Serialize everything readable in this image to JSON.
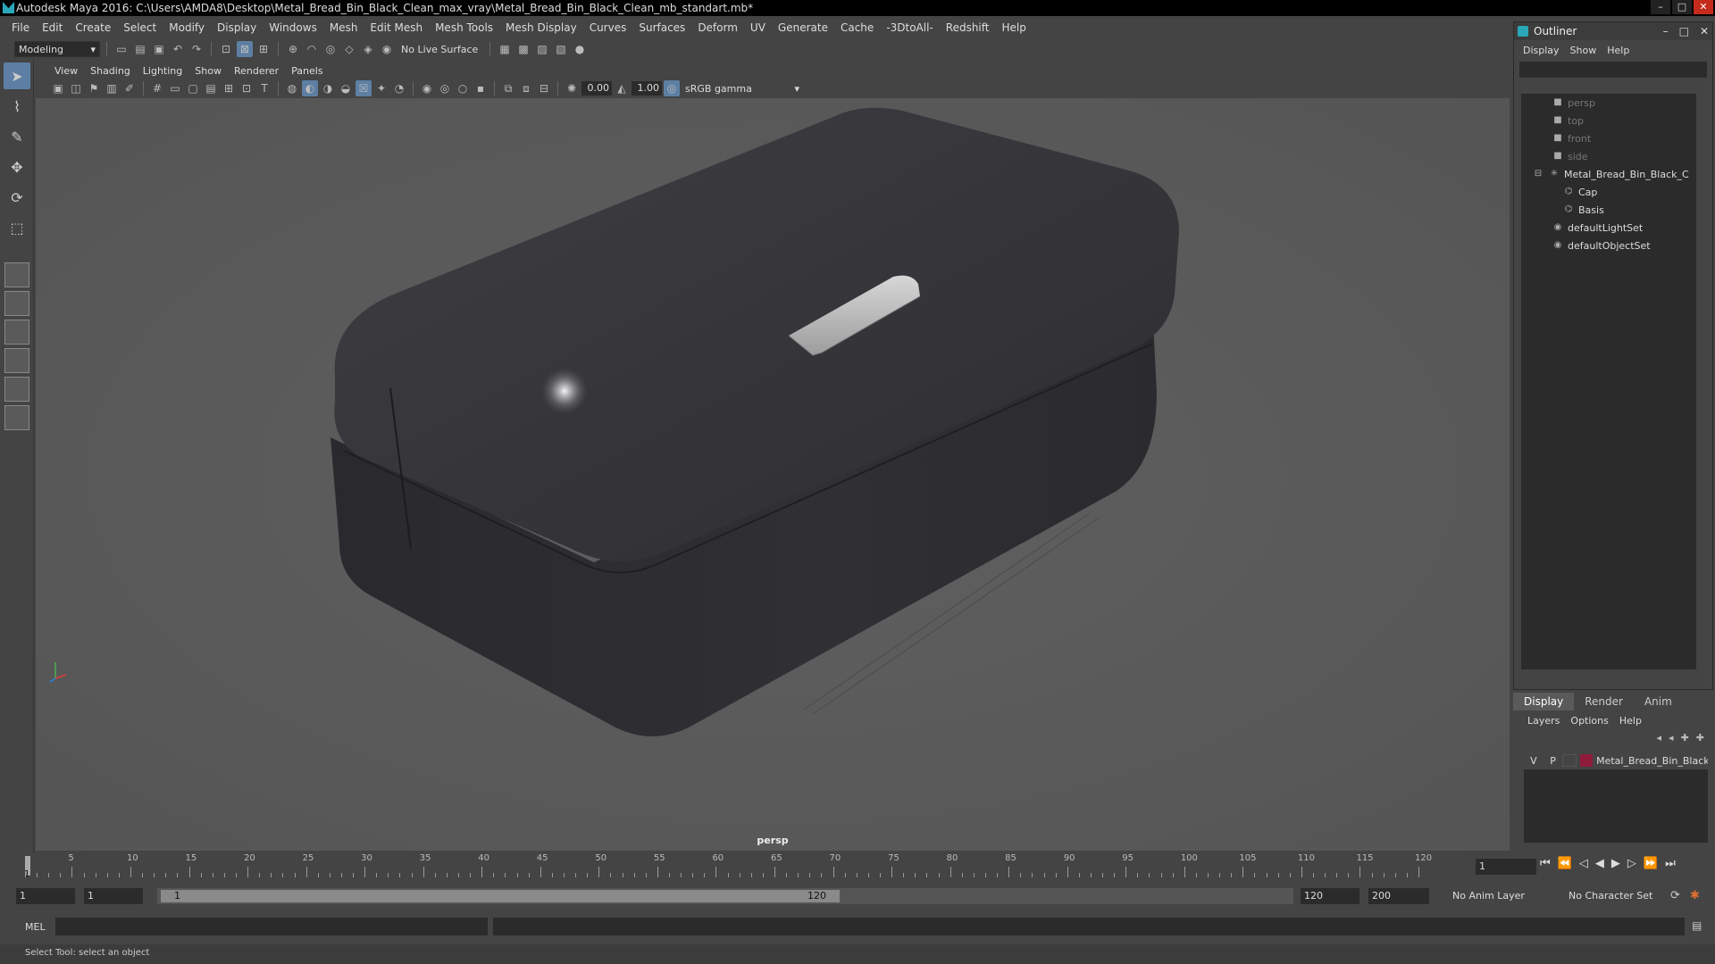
{
  "window": {
    "title": "Autodesk Maya 2016: C:\\Users\\AMDA8\\Desktop\\Metal_Bread_Bin_Black_Clean_max_vray\\Metal_Bread_Bin_Black_Clean_mb_standart.mb*",
    "minimize": "–",
    "maximize": "□",
    "close": "✕"
  },
  "menubar": [
    "File",
    "Edit",
    "Create",
    "Select",
    "Modify",
    "Display",
    "Windows",
    "Mesh",
    "Edit Mesh",
    "Mesh Tools",
    "Mesh Display",
    "Curves",
    "Surfaces",
    "Deform",
    "UV",
    "Generate",
    "Cache",
    "-3DtoAll-",
    "Redshift",
    "Help"
  ],
  "statusline": {
    "mode": "Modeling",
    "live_surface": "No Live Surface"
  },
  "panel": {
    "menus": [
      "View",
      "Shading",
      "Lighting",
      "Show",
      "Renderer",
      "Panels"
    ],
    "exposure": "0.00",
    "gamma": "1.00",
    "color_space": "sRGB gamma",
    "camera": "persp"
  },
  "outliner": {
    "title": "Outliner",
    "menus": [
      "Display",
      "Show",
      "Help"
    ],
    "items": [
      {
        "label": "persp",
        "dim": true
      },
      {
        "label": "top",
        "dim": true
      },
      {
        "label": "front",
        "dim": true
      },
      {
        "label": "side",
        "dim": true
      },
      {
        "label": "Metal_Bread_Bin_Black_C",
        "dim": false
      },
      {
        "label": "Cap",
        "dim": false
      },
      {
        "label": "Basis",
        "dim": false
      },
      {
        "label": "defaultLightSet",
        "dim": false
      },
      {
        "label": "defaultObjectSet",
        "dim": false
      }
    ]
  },
  "layer_editor": {
    "tabs": [
      "Display",
      "Render",
      "Anim"
    ],
    "menus": [
      "Layers",
      "Options",
      "Help"
    ],
    "layer": {
      "v": "V",
      "p": "P",
      "name": "Metal_Bread_Bin_Black",
      "color": "#8e1c3a"
    }
  },
  "timeline": {
    "ticks": [
      5,
      10,
      15,
      20,
      25,
      30,
      35,
      40,
      45,
      50,
      55,
      60,
      65,
      70,
      75,
      80,
      85,
      90,
      95,
      100,
      105,
      110,
      115,
      120
    ],
    "current_frame_label": "1",
    "current_frame_field": "1"
  },
  "range": {
    "start": "1",
    "playback_start": "1",
    "slider_start": "1",
    "slider_end": "120",
    "playback_end": "120",
    "end": "200",
    "anim_layer": "No Anim Layer",
    "character_set": "No Character Set"
  },
  "command_line": {
    "label": "MEL"
  },
  "help_line": "Select Tool: select an object"
}
